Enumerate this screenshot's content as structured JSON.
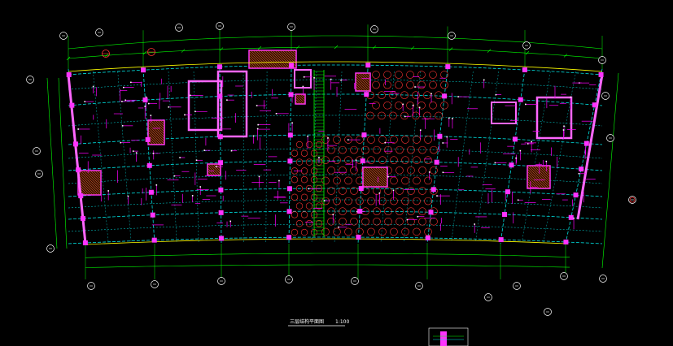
{
  "colors": {
    "background": "#000000",
    "grid_line": "#00e0e0",
    "dimension": "#00ff00",
    "column": "#ff33ff",
    "wall": "#ff66ff",
    "hatch": "#ff3333",
    "rebar": "#ff00ff",
    "text": "#ffffff",
    "edge": "#ffff00"
  },
  "drawing": {
    "title": "三层结构平面图",
    "scale": "1:100"
  },
  "icons": [
    "axis-bubble-icon",
    "north-arrow-icon"
  ]
}
